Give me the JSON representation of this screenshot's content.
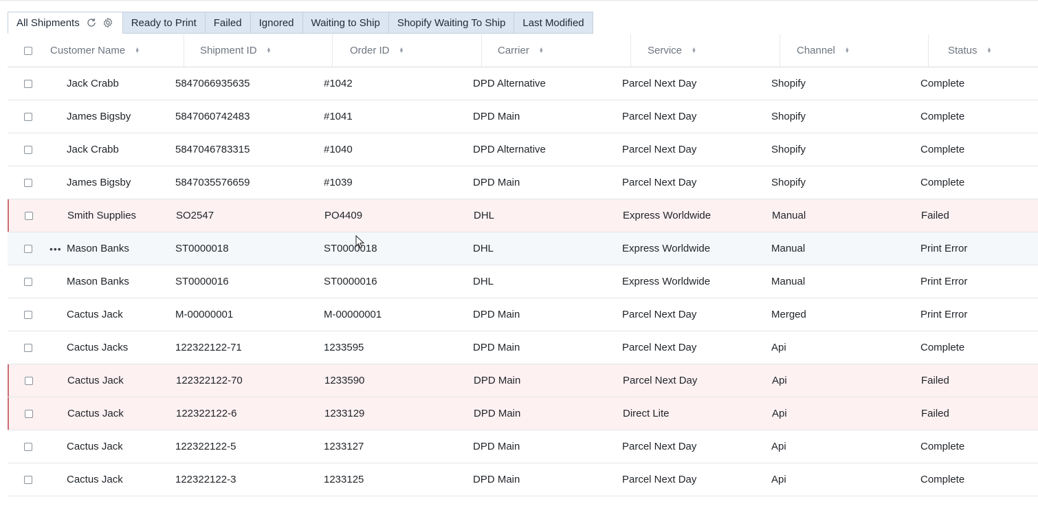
{
  "tabs": [
    {
      "label": "All Shipments",
      "active": true
    },
    {
      "label": "Ready to Print",
      "active": false
    },
    {
      "label": "Failed",
      "active": false
    },
    {
      "label": "Ignored",
      "active": false
    },
    {
      "label": "Waiting to Ship",
      "active": false
    },
    {
      "label": "Shopify Waiting To Ship",
      "active": false
    },
    {
      "label": "Last Modified",
      "active": false
    }
  ],
  "tab_icons": [
    "refresh-icon",
    "gear-icon"
  ],
  "columns": [
    "Customer Name",
    "Shipment ID",
    "Order ID",
    "Carrier",
    "Service",
    "Channel",
    "Status"
  ],
  "rows": [
    {
      "customer": "Jack Crabb",
      "shipment_id": "5847066935635",
      "order_id": "#1042",
      "carrier": "DPD Alternative",
      "service": "Parcel Next Day",
      "channel": "Shopify",
      "status": "Complete",
      "state": "normal"
    },
    {
      "customer": "James Bigsby",
      "shipment_id": "5847060742483",
      "order_id": "#1041",
      "carrier": "DPD Main",
      "service": "Parcel Next Day",
      "channel": "Shopify",
      "status": "Complete",
      "state": "normal"
    },
    {
      "customer": "Jack Crabb",
      "shipment_id": "5847046783315",
      "order_id": "#1040",
      "carrier": "DPD Alternative",
      "service": "Parcel Next Day",
      "channel": "Shopify",
      "status": "Complete",
      "state": "normal"
    },
    {
      "customer": "James Bigsby",
      "shipment_id": "5847035576659",
      "order_id": "#1039",
      "carrier": "DPD Main",
      "service": "Parcel Next Day",
      "channel": "Shopify",
      "status": "Complete",
      "state": "normal"
    },
    {
      "customer": "Smith Supplies",
      "shipment_id": "SO2547",
      "order_id": "PO4409",
      "carrier": "DHL",
      "service": "Express Worldwide",
      "channel": "Manual",
      "status": "Failed",
      "state": "failed"
    },
    {
      "customer": "Mason Banks",
      "shipment_id": "ST0000018",
      "order_id": "ST0000018",
      "carrier": "DHL",
      "service": "Express Worldwide",
      "channel": "Manual",
      "status": "Print Error",
      "state": "hover"
    },
    {
      "customer": "Mason Banks",
      "shipment_id": "ST0000016",
      "order_id": "ST0000016",
      "carrier": "DHL",
      "service": "Express Worldwide",
      "channel": "Manual",
      "status": "Print Error",
      "state": "normal"
    },
    {
      "customer": "Cactus Jack",
      "shipment_id": "M-00000001",
      "order_id": "M-00000001",
      "carrier": "DPD Main",
      "service": "Parcel Next Day",
      "channel": "Merged",
      "status": "Print Error",
      "state": "normal"
    },
    {
      "customer": "Cactus Jacks",
      "shipment_id": "122322122-71",
      "order_id": "1233595",
      "carrier": "DPD Main",
      "service": "Parcel Next Day",
      "channel": "Api",
      "status": "Complete",
      "state": "normal"
    },
    {
      "customer": "Cactus Jack",
      "shipment_id": "122322122-70",
      "order_id": "1233590",
      "carrier": "DPD Main",
      "service": "Parcel Next Day",
      "channel": "Api",
      "status": "Failed",
      "state": "failed"
    },
    {
      "customer": "Cactus Jack",
      "shipment_id": "122322122-6",
      "order_id": "1233129",
      "carrier": "DPD Main",
      "service": "Direct Lite",
      "channel": "Api",
      "status": "Failed",
      "state": "failed"
    },
    {
      "customer": "Cactus Jack",
      "shipment_id": "122322122-5",
      "order_id": "1233127",
      "carrier": "DPD Main",
      "service": "Parcel Next Day",
      "channel": "Api",
      "status": "Complete",
      "state": "normal"
    },
    {
      "customer": "Cactus Jack",
      "shipment_id": "122322122-3",
      "order_id": "1233125",
      "carrier": "DPD Main",
      "service": "Parcel Next Day",
      "channel": "Api",
      "status": "Complete",
      "state": "normal"
    }
  ],
  "row_actions_glyph": "•••",
  "colors": {
    "tab_background": "#dce6f2",
    "failed_row_background": "#fdf1f2",
    "failed_row_marker": "#c96b74",
    "header_text": "#6d7580"
  }
}
